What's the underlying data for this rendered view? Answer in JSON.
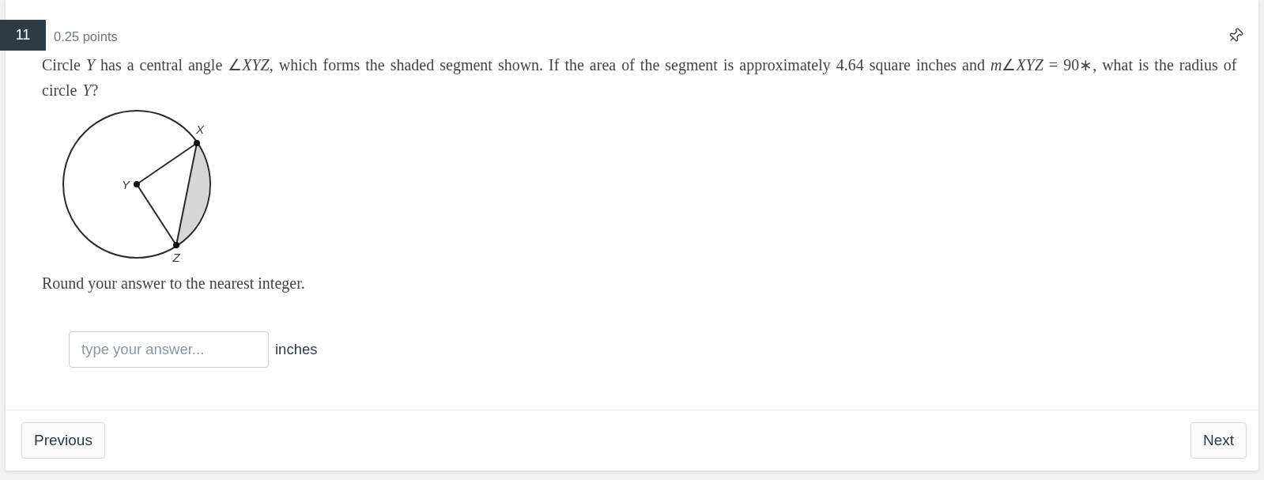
{
  "question": {
    "number": "11",
    "points": "0.25 points",
    "text": "Circle *Y* has a central angle ∠*XYZ*, which forms the shaded segment shown. If the area of the segment is approximately 4.64 square inches and *m*∠*XYZ* = 90∗, what is the radius of circle *Y*?"
  },
  "diagram": {
    "points": [
      {
        "label": "X"
      },
      {
        "label": "Y"
      },
      {
        "label": "Z"
      }
    ]
  },
  "instruction": "Round your answer to the nearest integer.",
  "answer": {
    "placeholder": "type your answer...",
    "unit": "inches"
  },
  "buttons": [
    {
      "label": "Previous"
    },
    {
      "label": "Next"
    }
  ]
}
